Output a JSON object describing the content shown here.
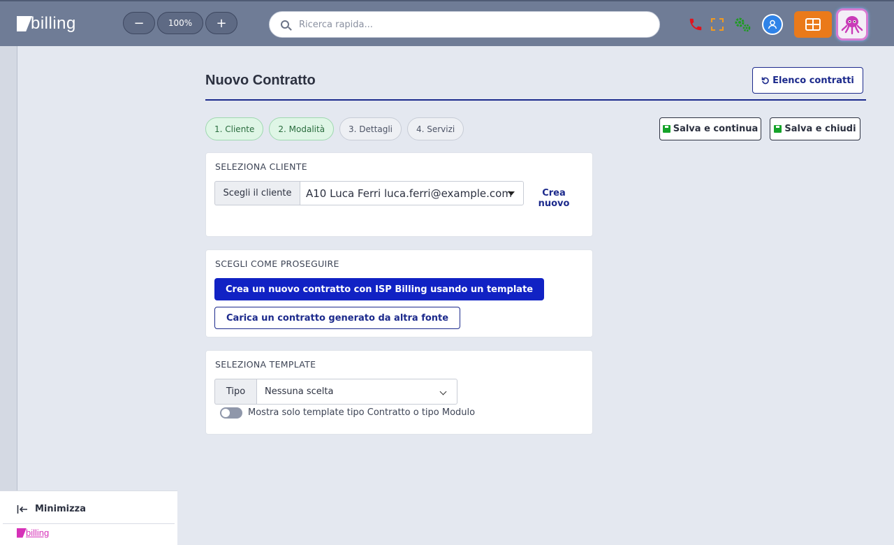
{
  "app": {
    "logo_text": "billing",
    "footer_logo_text": "billing"
  },
  "toolbar": {
    "zoom_out": "−",
    "zoom_level": "100%",
    "zoom_in": "+",
    "search_placeholder": "Ricerca rapida..."
  },
  "colors": {
    "topbar": "#6f7c96",
    "accent": "#1c2a8c",
    "primary": "#1122c4",
    "orange": "#ea7a1a",
    "success": "#16a32a"
  },
  "icons": {
    "phone": "phone-icon",
    "fullscreen": "fullscreen-icon",
    "settings": "gears-icon",
    "user": "user-icon",
    "apps": "grid-icon",
    "avatar": "octopus-avatar"
  },
  "page": {
    "title": "Nuovo Contratto",
    "list_button": "Elenco contratti",
    "save_continue": "Salva e continua",
    "save_close": "Salva e chiudi"
  },
  "steps": [
    {
      "label": "1. Cliente",
      "done": true
    },
    {
      "label": "2. Modalità",
      "done": true
    },
    {
      "label": "3. Dettagli",
      "done": false
    },
    {
      "label": "4. Servizi",
      "done": false
    }
  ],
  "client_section": {
    "title": "SELEZIONA CLIENTE",
    "addon_label": "Scegli il cliente",
    "selected_value": "A10 Luca Ferri luca.ferri@example.com",
    "create_new": "Crea nuovo"
  },
  "proceed_section": {
    "title": "SCEGLI COME PROSEGUIRE",
    "primary_option": "Crea un nuovo contratto con ISP Billing usando un template",
    "secondary_option": "Carica un contratto generato da altra fonte"
  },
  "template_section": {
    "title": "SELEZIONA TEMPLATE",
    "type_label": "Tipo",
    "type_value": "Nessuna scelta",
    "toggle_label": "Mostra solo template tipo Contratto o tipo Modulo"
  },
  "sidebar": {
    "minimize_label": "Minimizza"
  }
}
